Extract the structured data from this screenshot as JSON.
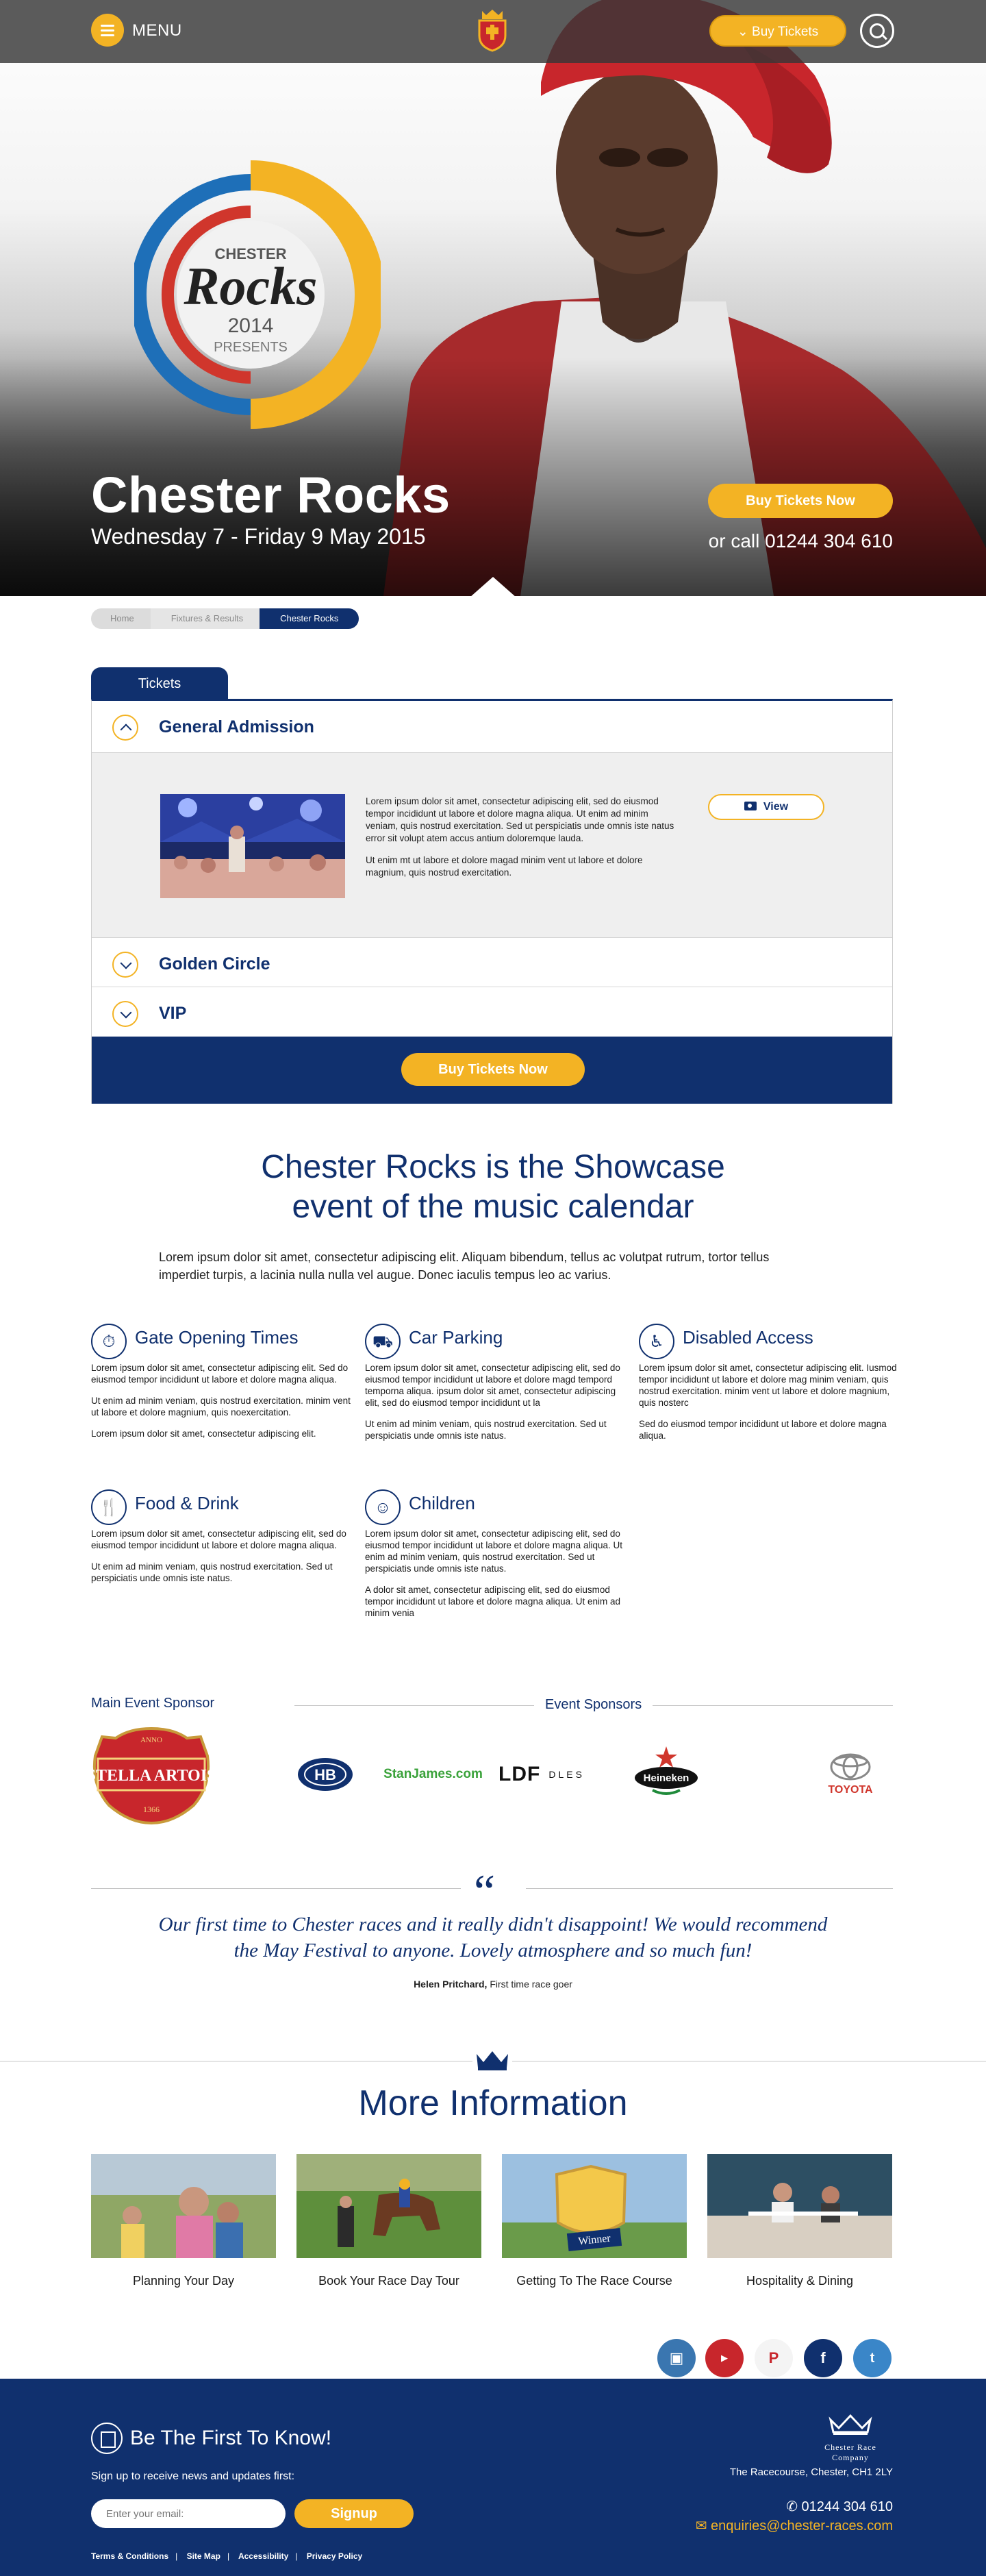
{
  "header": {
    "menu_label": "MENU",
    "buy_tickets_label": "Buy Tickets"
  },
  "hero": {
    "logo": {
      "top": "CHESTER",
      "script": "Rocks",
      "year": "2014",
      "sub": "PRESENTS"
    },
    "title": "Chester Rocks",
    "date": "Wednesday 7 - Friday 9 May 2015",
    "buy_label": "Buy Tickets Now",
    "call_text": "or call 01244 304 610"
  },
  "breadcrumb": [
    "Home",
    "Fixtures & Results",
    "Chester Rocks"
  ],
  "tickets": {
    "tab_label": "Tickets",
    "sections": [
      {
        "title": "General Admission",
        "expanded": true
      },
      {
        "title": "Golden Circle",
        "expanded": false
      },
      {
        "title": "VIP",
        "expanded": false
      }
    ],
    "body_p1": "Lorem ipsum dolor sit amet, consectetur adipiscing elit, sed do eiusmod tempor incididunt ut labore et dolore magna aliqua. Ut enim ad minim veniam, quis nostrud exercitation. Sed ut perspiciatis unde omnis iste natus error sit volupt atem accus antium doloremque lauda.",
    "body_p2": "Ut enim mt ut labore et dolore magad minim vent ut labore et dolore magnium, quis nostrud exercitation.",
    "view_label": "View",
    "buy_label": "Buy Tickets Now"
  },
  "showcase": {
    "title_line1": "Chester Rocks is the Showcase",
    "title_line2": "event of the music calendar",
    "text": "Lorem ipsum dolor sit amet, consectetur adipiscing elit. Aliquam bibendum, tellus ac volutpat rutrum, tortor tellus imperdiet turpis, a lacinia nulla nulla vel augue. Donec iaculis tempus leo ac varius."
  },
  "info": [
    {
      "title": "Gate Opening Times",
      "icon": "stopwatch-icon",
      "p": [
        "Lorem ipsum dolor sit amet, consectetur adipiscing elit. Sed do eiusmod tempor incididunt ut labore et dolore magna aliqua.",
        "Ut enim ad minim veniam, quis nostrud exercitation. minim vent ut labore et dolore magnium, quis noexercitation.",
        "Lorem ipsum dolor sit amet, consectetur adipiscing elit."
      ]
    },
    {
      "title": "Car Parking",
      "icon": "car-icon",
      "p": [
        "Lorem ipsum dolor sit amet, consectetur adipiscing elit, sed do eiusmod tempor incididunt ut labore et dolore magd tempord temporna aliqua.  ipsum dolor sit amet, consectetur adipiscing elit, sed do eiusmod tempor incididunt ut la",
        "Ut enim ad minim veniam, quis nostrud exercitation. Sed ut perspiciatis unde omnis iste natus."
      ]
    },
    {
      "title": "Disabled Access",
      "icon": "wheelchair-icon",
      "p": [
        "Lorem ipsum dolor sit amet, consectetur adipiscing elit. Iusmod tempor incididunt ut labore et dolore mag minim veniam, quis nostrud exercitation. minim vent ut labore et dolore magnium, quis nosterc",
        "Sed do eiusmod tempor incididunt ut labore et dolore magna aliqua."
      ]
    },
    {
      "title": "Food & Drink",
      "icon": "cutlery-icon",
      "p": [
        "Lorem ipsum dolor sit amet, consectetur adipiscing elit, sed do eiusmod tempor incididunt ut labore et dolore magna aliqua.",
        "Ut enim ad minim veniam, quis nostrud exercitation. Sed ut perspiciatis unde omnis iste natus."
      ]
    },
    {
      "title": "Children",
      "icon": "child-icon",
      "p": [
        "Lorem ipsum dolor sit amet, consectetur adipiscing elit, sed do eiusmod tempor incididunt ut labore et dolore magna aliqua.  Ut enim ad minim veniam, quis nostrud exercitation. Sed ut perspiciatis unde omnis iste natus.",
        "A dolor sit amet, consectetur adipiscing elit, sed do eiusmod tempor incididunt ut labore et dolore magna aliqua.  Ut enim ad minim venia"
      ]
    }
  ],
  "sponsors": {
    "main_label": "Main Event Sponsor",
    "event_label": "Event Sponsors",
    "main": {
      "name": "STELLA ARTOIS",
      "top": "ANNO",
      "year": "1366"
    },
    "event": [
      "HB",
      "StanJames.com",
      "LDF",
      "DLES",
      "Heineken",
      "TOYOTA"
    ]
  },
  "testimonial": {
    "quote_mark": "“",
    "text_line1": "Our first time to Chester races and it really didn't disappoint! We would recommend",
    "text_line2": "the May Festival to anyone. Lovely atmosphere and so much fun!",
    "author": "Helen Pritchard,",
    "role": " First time race goer"
  },
  "more_info": {
    "title": "More Information",
    "cards": [
      {
        "label": "Planning Your Day"
      },
      {
        "label": "Book Your Race Day Tour"
      },
      {
        "label": "Getting To The Race Course",
        "badge": "Winner"
      },
      {
        "label": "Hospitality & Dining"
      }
    ]
  },
  "social": [
    "instagram",
    "youtube",
    "pinterest",
    "facebook",
    "twitter"
  ],
  "footer": {
    "news_title": "Be The First To Know!",
    "news_sub": "Sign up to receive news and updates first:",
    "email_placeholder": "Enter your email:",
    "signup_label": "Signup",
    "links": [
      "Terms & Conditions",
      "Site Map",
      "Accessibility",
      "Privacy Policy"
    ],
    "company_name": "Chester Race Company",
    "address": "The Racecourse, Chester, CH1 2LY",
    "phone": "01244 304 610",
    "email": "enquiries@chester-races.com"
  },
  "colors": {
    "navy": "#10306e",
    "gold": "#f3b324",
    "red": "#d0362c",
    "blue": "#1e6fb8"
  }
}
